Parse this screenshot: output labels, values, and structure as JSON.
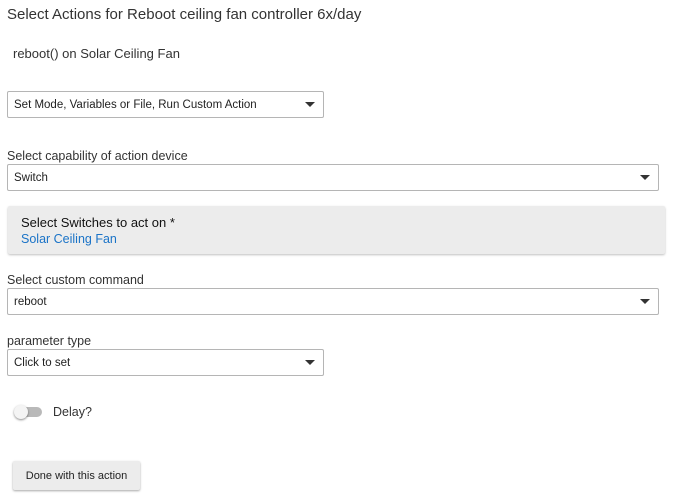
{
  "page": {
    "title": "Select Actions for Reboot ceiling fan controller 6x/day",
    "summary": "reboot() on Solar Ceiling Fan"
  },
  "action_type": {
    "selected": "Set Mode, Variables or File, Run Custom Action"
  },
  "capability": {
    "label": "Select capability of action device",
    "selected": "Switch"
  },
  "devices": {
    "title": "Select Switches to act on *",
    "selected": "Solar Ceiling Fan"
  },
  "custom_command": {
    "label": "Select custom command",
    "selected": "reboot"
  },
  "parameter_type": {
    "label": "parameter type",
    "selected": "Click to set"
  },
  "delay": {
    "label": "Delay?",
    "enabled": false
  },
  "done_button": {
    "label": "Done with this action"
  },
  "colors": {
    "link": "#1a73c7",
    "panel_background": "#ececec"
  }
}
